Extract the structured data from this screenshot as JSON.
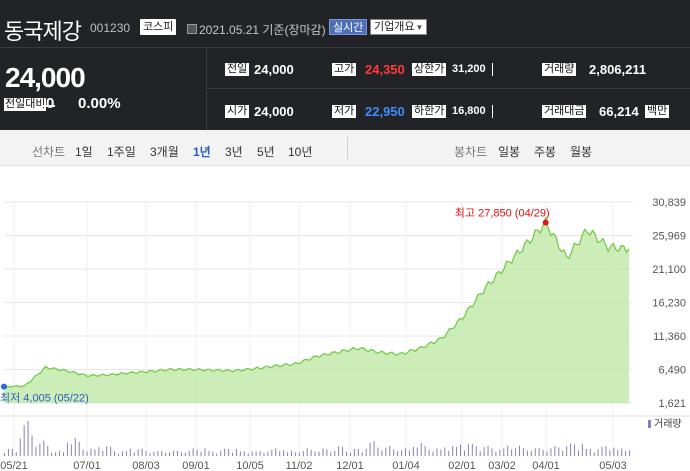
{
  "stock": {
    "name": "동국제강",
    "code": "001230",
    "market_badge": "코스피",
    "date_text": "2021.05.21 기준(장마감)",
    "live_button": "실시간",
    "info_button": "기업개요"
  },
  "price": {
    "current": "24,000",
    "diff_label": "전일대비",
    "diff_value": "0",
    "diff_rate": "0.00%"
  },
  "stats": {
    "prev_close_label": "전일",
    "prev_close": "24,000",
    "high_label": "고가",
    "high": "24,350",
    "upper_limit_label": "상한가",
    "upper_limit": "31,200",
    "volume_label": "거래량",
    "volume": "2,806,211",
    "open_label": "시가",
    "open": "24,000",
    "low_label": "저가",
    "low": "22,950",
    "lower_limit_label": "하한가",
    "lower_limit": "16,800",
    "amount_label": "거래대금",
    "amount": "66,214",
    "amount_unit": "백만"
  },
  "tabs": {
    "line_label": "선차트",
    "periods": [
      "1일",
      "1주일",
      "3개월",
      "1년",
      "3년",
      "5년",
      "10년"
    ],
    "active_period": "1년",
    "candle_label": "봉차트",
    "candles": [
      "일봉",
      "주봉",
      "월봉"
    ]
  },
  "colors": {
    "up": "#ff3a3a",
    "down": "#3f8cff",
    "line": "#6dc83f",
    "fill": "#bfe8a6",
    "active_tab": "#2a5bc4"
  },
  "chart_data": {
    "type": "area",
    "y_ticks": [
      "30,839",
      "25,969",
      "21,100",
      "16,230",
      "11,360",
      "6,490",
      "1,621"
    ],
    "ylim": [
      1621,
      30839
    ],
    "x_ticks": [
      "05/21",
      "07/01",
      "08/03",
      "09/01",
      "10/05",
      "11/02",
      "12/01",
      "01/04",
      "02/01",
      "03/02",
      "04/01",
      "05/03"
    ],
    "max_label": "최고 27,850 (04/29)",
    "min_label": "최저 4,005 (05/22)",
    "volume_label": "거래량",
    "series": [
      {
        "x": [
          "05/21",
          "05/22",
          "06/01",
          "06/10",
          "06/20",
          "07/01",
          "07/15",
          "08/03",
          "08/20",
          "09/01",
          "09/20",
          "10/05",
          "10/20",
          "11/02",
          "11/15",
          "12/01",
          "12/15",
          "01/04",
          "01/20",
          "02/01",
          "02/15",
          "03/02",
          "03/15",
          "04/01",
          "04/10",
          "04/20",
          "04/29",
          "05/06",
          "05/12",
          "05/18",
          "05/21"
        ],
        "values": [
          4005,
          4100,
          6800,
          6300,
          5600,
          5700,
          6000,
          6200,
          6500,
          6500,
          6400,
          6300,
          6600,
          7000,
          7300,
          8400,
          9000,
          9600,
          9000,
          8700,
          9600,
          11000,
          14000,
          18000,
          21300,
          24500,
          27850,
          22700,
          26800,
          24300,
          24000
        ]
      }
    ],
    "volume": [
      3,
      14,
      6,
      2,
      7,
      3,
      4,
      2,
      3,
      2,
      2,
      2,
      3,
      2,
      3,
      2,
      2,
      3,
      2,
      3,
      3,
      4,
      3,
      6,
      4,
      3,
      5,
      3,
      4,
      5,
      4,
      3,
      4,
      3,
      3,
      4,
      5,
      3,
      4,
      3
    ]
  }
}
